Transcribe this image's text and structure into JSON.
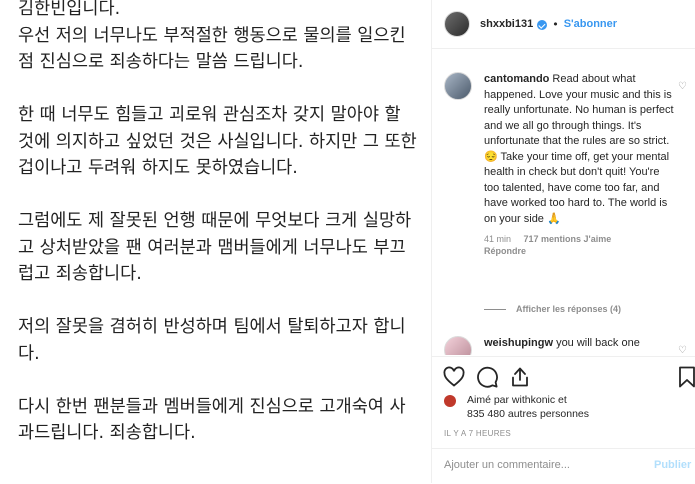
{
  "post": {
    "text": "김한빈입니다.\n우선 저의 너무나도 부적절한 행동으로 물의를 일으킨 점 진심으로 죄송하다는 말씀 드립니다.\n\n한 때 너무도 힘들고 괴로워 관심조차 갖지 말아야 할 것에 의지하고 싶었던 것은 사실입니다. 하지만 그 또한 겁이나고 두려워 하지도 못하였습니다.\n\n그럼에도 제 잘못된 언행 때문에 무엇보다 크게 실망하고 상처받았을 팬 여러분과 맴버들에게 너무나도 부끄럽고 죄송합니다.\n\n저의 잘못을 겸허히 반성하며 팀에서 탈퇴하고자 합니다.\n\n다시 한번 팬분들과 멤버들에게 진심으로 고개숙여 사과드립니다. 죄송합니다."
  },
  "header": {
    "username": "shxxbi131",
    "separator": "•",
    "follow_label": "S'abonner"
  },
  "comments": [
    {
      "username": "cantomando",
      "text": "Read about what happened. Love your music and this is really unfortunate. No human is perfect and we all go through things. It's unfortunate that the rules are so strict. 😔 Take your time off, get your mental health in check but don't quit! You're too talented, have come too far, and have worked too hard to. The world is on your side 🙏",
      "time": "41 min",
      "likes": "717 mentions J'aime",
      "reply": "Répondre",
      "view_replies": "Afficher les réponses (4)"
    },
    {
      "username": "weishupingw",
      "text": "you will back one"
    }
  ],
  "likes": {
    "line1": "Aimé par withkonic et",
    "line2": "835 480 autres personnes"
  },
  "timestamp": "IL Y A 7 HEURES",
  "add_comment": {
    "placeholder": "Ajouter un commentaire...",
    "publish_label": "Publier"
  },
  "icons": [
    "heart-icon",
    "comment-icon",
    "share-icon",
    "bookmark-icon",
    "verified-icon"
  ]
}
